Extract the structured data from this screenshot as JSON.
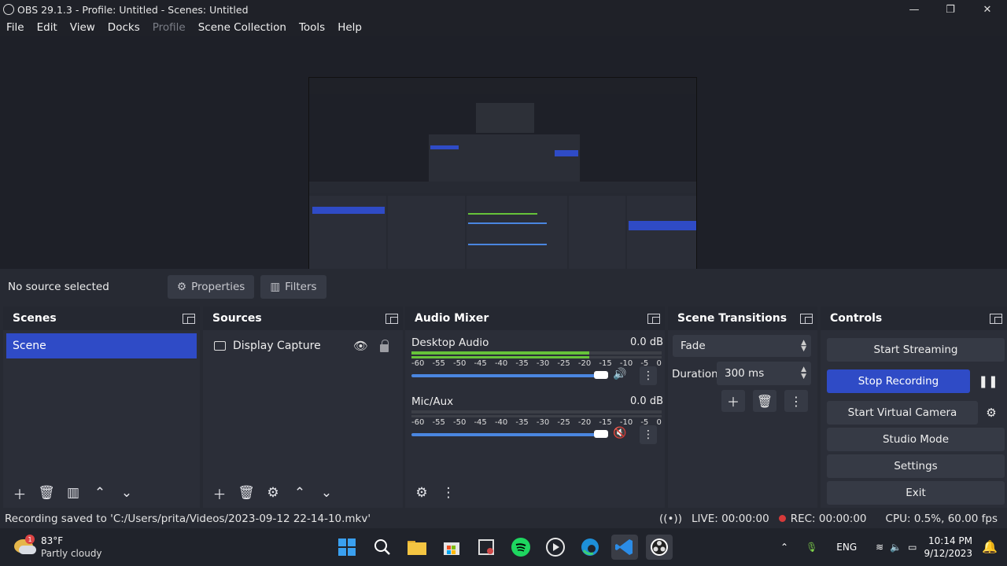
{
  "window": {
    "title": "OBS 29.1.3 - Profile: Untitled - Scenes: Untitled",
    "minimize": "—",
    "maximize": "❐",
    "close": "✕"
  },
  "menu": [
    "File",
    "Edit",
    "View",
    "Docks",
    "Profile",
    "Scene Collection",
    "Tools",
    "Help"
  ],
  "source_toolbar": {
    "no_source": "No source selected",
    "properties": "Properties",
    "filters": "Filters"
  },
  "scenes": {
    "title": "Scenes",
    "items": [
      "Scene"
    ]
  },
  "sources": {
    "title": "Sources",
    "items": [
      "Display Capture"
    ]
  },
  "mixer": {
    "title": "Audio Mixer",
    "ticks": [
      "-60",
      "-55",
      "-50",
      "-45",
      "-40",
      "-35",
      "-30",
      "-25",
      "-20",
      "-15",
      "-10",
      "-5",
      "0"
    ],
    "channels": [
      {
        "name": "Desktop Audio",
        "db": "0.0 dB",
        "level": 0.71,
        "volume": 1.0,
        "muted": false
      },
      {
        "name": "Mic/Aux",
        "db": "0.0 dB",
        "level": 0.0,
        "volume": 1.0,
        "muted": true
      }
    ]
  },
  "transitions": {
    "title": "Scene Transitions",
    "selected": "Fade",
    "duration_label": "Duration",
    "duration_value": "300 ms"
  },
  "controls": {
    "title": "Controls",
    "start_streaming": "Start Streaming",
    "stop_recording": "Stop Recording",
    "start_virtual_camera": "Start Virtual Camera",
    "studio_mode": "Studio Mode",
    "settings": "Settings",
    "exit": "Exit"
  },
  "status": {
    "message": "Recording saved to 'C:/Users/prita/Videos/2023-09-12 22-14-10.mkv'",
    "live": "LIVE: 00:00:00",
    "rec": "REC: 00:00:00",
    "cpu": "CPU: 0.5%, 60.00 fps"
  },
  "taskbar": {
    "weather_temp": "83°F",
    "weather_cond": "Partly cloudy",
    "weather_badge": "1",
    "lang": "ENG",
    "time": "10:14 PM",
    "date": "9/12/2023"
  },
  "colors": {
    "accent": "#2f4bc6",
    "meter_green": "#66c33a",
    "meter_yellow": "#c9b43a",
    "meter_red": "#c53a3a",
    "rec_dot": "#d63a3a"
  }
}
